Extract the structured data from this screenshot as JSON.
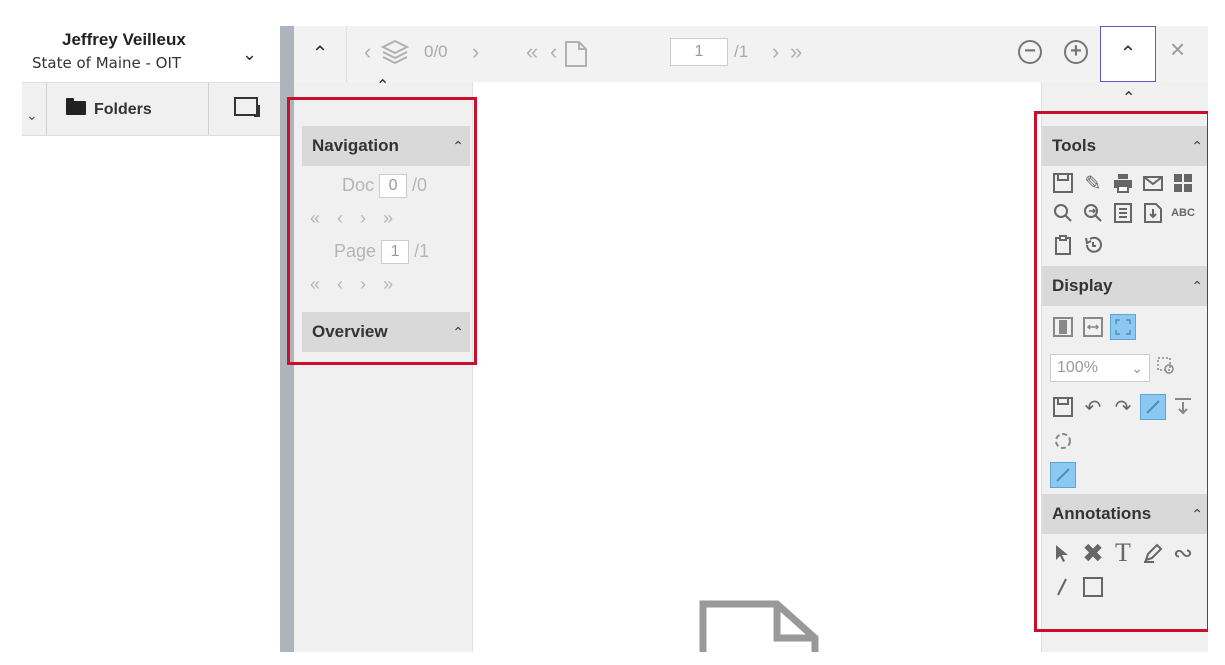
{
  "user": {
    "name": "Jeffrey Veilleux",
    "org": "State of Maine - OIT"
  },
  "left_tabs": {
    "folders_label": "Folders"
  },
  "toolbar": {
    "doc_counter": "0/0",
    "page_value": "1",
    "page_total": "/1"
  },
  "navigation": {
    "title": "Navigation",
    "doc_label": "Doc",
    "doc_value": "0",
    "doc_total": "/0",
    "page_label": "Page",
    "page_value": "1",
    "page_total": "/1",
    "overview_title": "Overview"
  },
  "tools_panel": {
    "tools_title": "Tools",
    "display_title": "Display",
    "zoom_value": "100%",
    "annotations_title": "Annotations",
    "colors": {
      "highlight": "#8cc8f0",
      "annotation_red": "#c8102e"
    }
  }
}
